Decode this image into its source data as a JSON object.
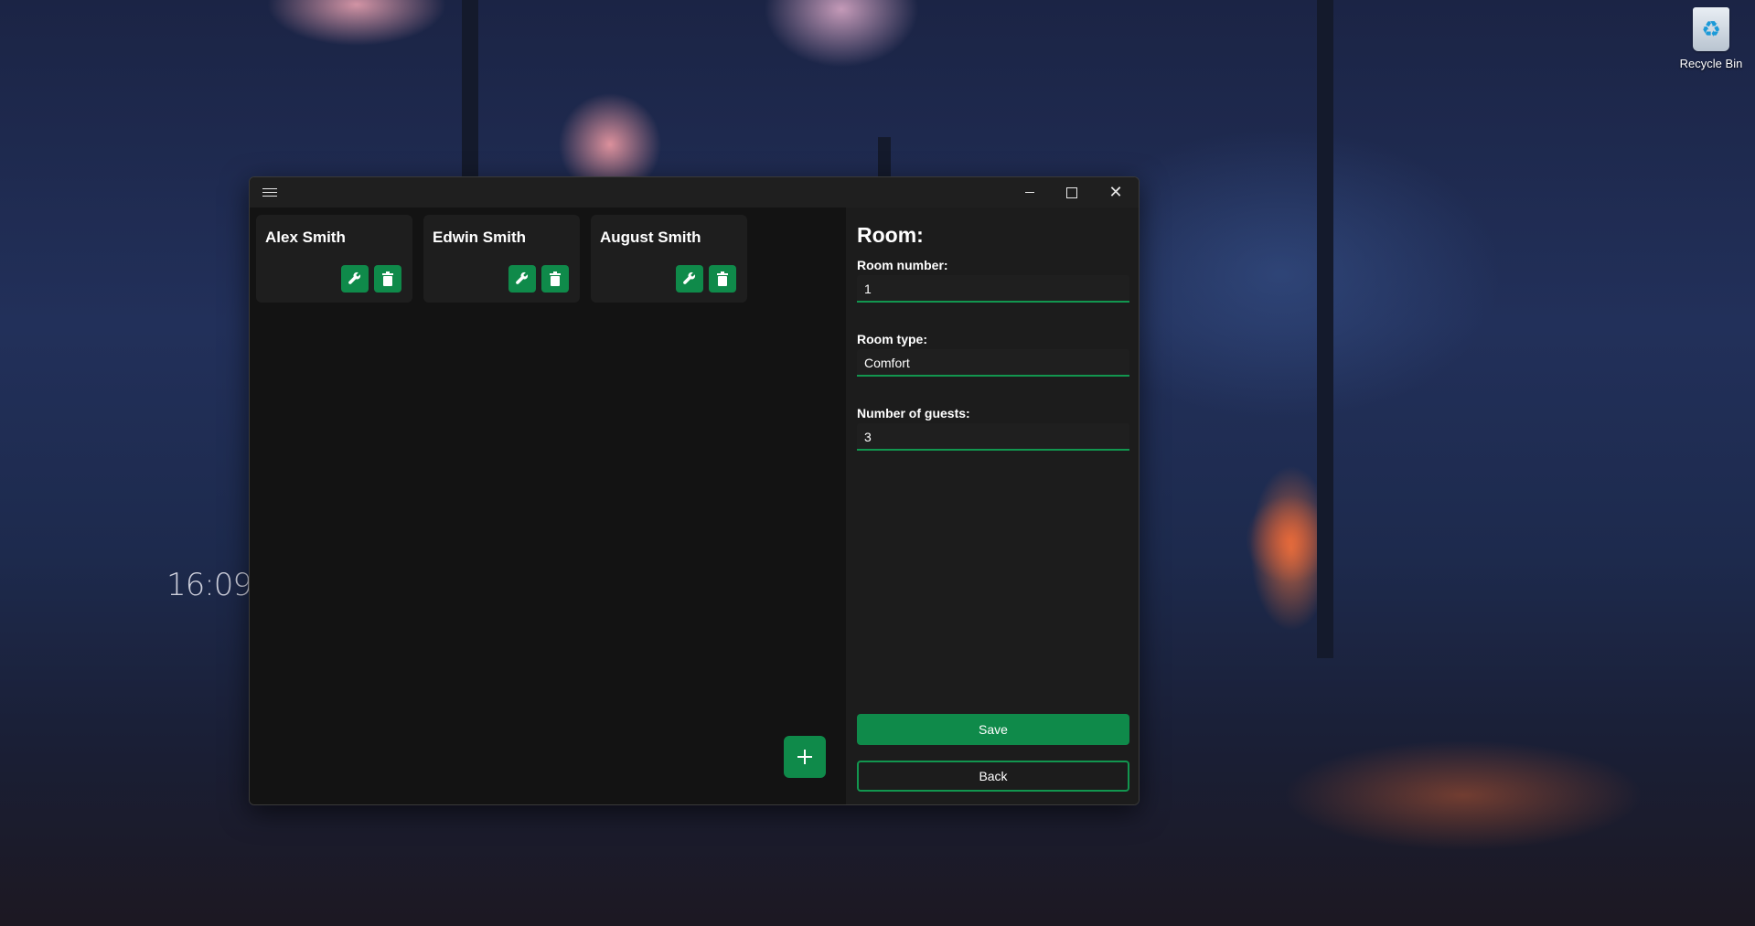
{
  "desktop": {
    "recycle_bin_label": "Recycle Bin",
    "clock_time": "16:09"
  },
  "window": {
    "menu_icon": "hamburger-icon",
    "controls": [
      "minimize-icon",
      "maximize-icon",
      "close-icon"
    ],
    "accent_color": "#0f8a4a"
  },
  "guests": {
    "cards": [
      {
        "name": "Alex Smith"
      },
      {
        "name": "Edwin Smith"
      },
      {
        "name": "August Smith"
      }
    ],
    "edit_icon": "wrench-icon",
    "delete_icon": "trash-icon",
    "add_icon": "plus-icon"
  },
  "room_form": {
    "title": "Room:",
    "room_number_label": "Room number:",
    "room_number_value": "1",
    "room_type_label": "Room type:",
    "room_type_value": "Comfort",
    "guests_label": "Number of guests:",
    "guests_value": "3",
    "save_label": "Save",
    "back_label": "Back"
  }
}
